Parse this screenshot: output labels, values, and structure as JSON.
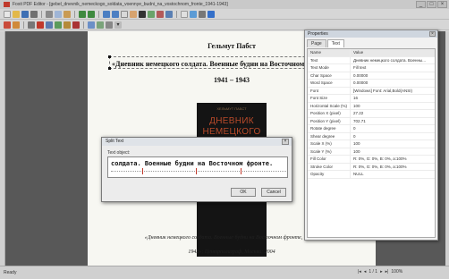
{
  "window": {
    "title": "Foxit PDF Editor - [gebel_dnevnik_nemeckogo_soldata_voennye_budni_na_vostochnom_fronte_1941-1943]",
    "controls": [
      "_",
      "□",
      "×"
    ]
  },
  "toolbar_row1_icons": [
    "new-icon",
    "open-icon",
    "save-icon",
    "print-icon",
    "cut-icon",
    "copy-icon",
    "paste-icon",
    "undo-icon",
    "redo-icon",
    "zoom-in-icon",
    "zoom-out-icon",
    "select-icon",
    "hand-icon",
    "text-icon",
    "image-icon",
    "shape-icon",
    "link-icon",
    "page-icon",
    "rotate-icon",
    "find-icon",
    "help-icon"
  ],
  "toolbar_row2_icons": [
    "bold-icon",
    "italic-icon",
    "align-icon",
    "color-icon",
    "font-icon",
    "size-icon",
    "edit-icon",
    "delete-icon",
    "layer-icon",
    "group-icon",
    "arrange-icon",
    "arrow-down-icon"
  ],
  "document": {
    "author": "Гельмут Пабст",
    "headline": "«Дневник немецкого солдата. Военные будни на Восточном фронте.",
    "years": "1941 – 1943",
    "cover_header": "ХЕЛЬМУТ ПАБСТ",
    "cover_title_1": "ДНЕВНИК",
    "cover_title_2": "НЕМЕЦКОГО",
    "caption": "«Дневник немецкого солдата. Военные будни на Восточном фронте, 1941 »",
    "pubinfo": "1942»; Центрполиграф, Москва; 2004"
  },
  "properties": {
    "title": "Properties",
    "tabs": [
      "Page",
      "Text"
    ],
    "active_tab": "Text",
    "rows": [
      {
        "key": "Name",
        "value": "Value"
      },
      {
        "key": "Text",
        "value": "Дневник немецкого солдата. Военны..."
      },
      {
        "key": "Text Mode",
        "value": "Fill text"
      },
      {
        "key": "Char Space",
        "value": "0.00000"
      },
      {
        "key": "Word Space",
        "value": "0.00000"
      },
      {
        "key": "Font",
        "value": "[Windows] Font: Arial,Bold(ANSI)"
      },
      {
        "key": "Font Size",
        "value": "16"
      },
      {
        "key": "Horizontal Scale (%)",
        "value": "100"
      },
      {
        "key": "Position X (pixel)",
        "value": "27.22"
      },
      {
        "key": "Position Y (pixel)",
        "value": "702.71"
      },
      {
        "key": "Rotate degree",
        "value": "0"
      },
      {
        "key": "Shear degree",
        "value": "0"
      },
      {
        "key": "Scale X (%)",
        "value": "100"
      },
      {
        "key": "Scale Y (%)",
        "value": "100"
      },
      {
        "key": "Fill Color",
        "value": "R: 0%, G: 0%, B: 0%, a:100%"
      },
      {
        "key": "Stroke Color",
        "value": "R: 0%, G: 0%, B: 0%, a:100%"
      },
      {
        "key": "Opacity",
        "value": "NULL"
      }
    ]
  },
  "split_dialog": {
    "title": "Split Text",
    "label": "Text object:",
    "text": "солдата. Военные будни на Восточном фронте.",
    "ok": "OK",
    "cancel": "Cancel"
  },
  "status": {
    "ready": "Ready",
    "page_indicator": "1 / 1",
    "zoom": "100%"
  }
}
